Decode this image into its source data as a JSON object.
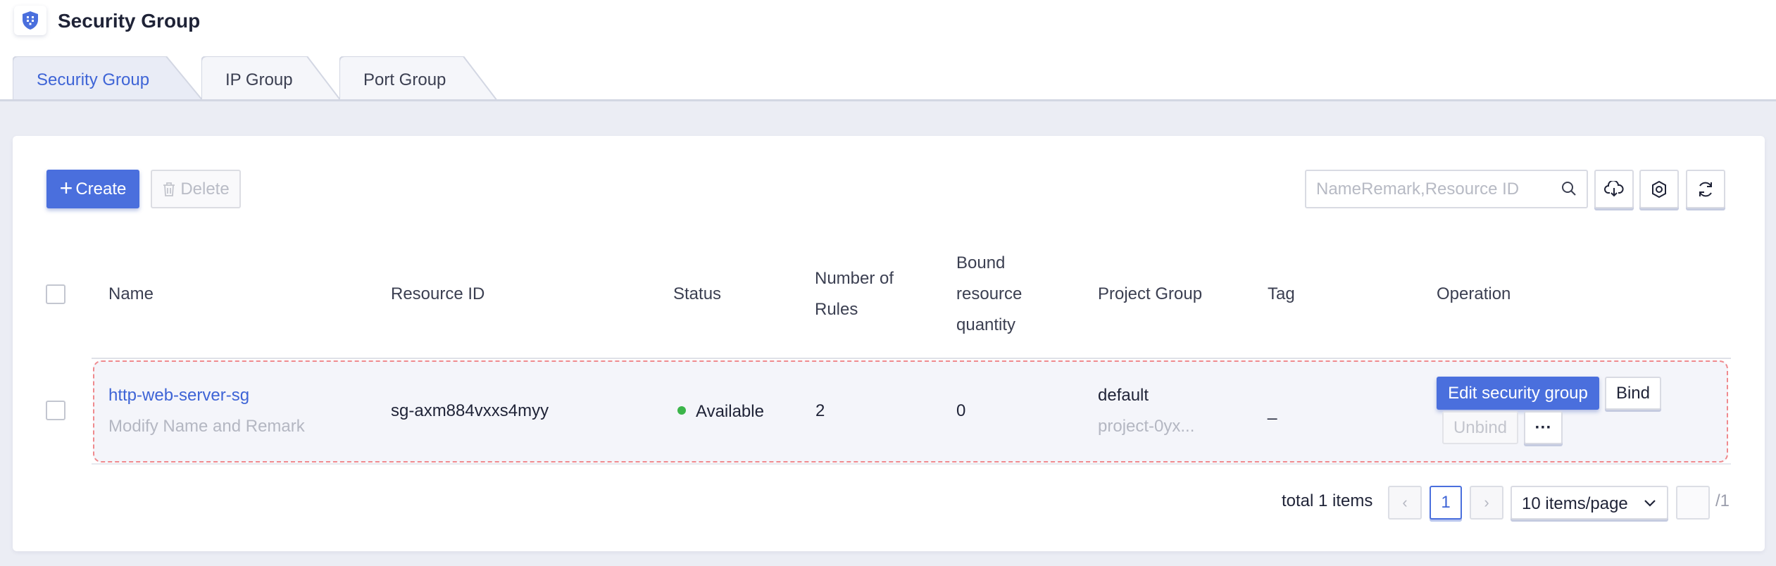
{
  "header": {
    "title": "Security Group",
    "logo_icon": "shield-icon"
  },
  "tabs": [
    {
      "label": "Security Group",
      "active": true
    },
    {
      "label": "IP Group",
      "active": false
    },
    {
      "label": "Port Group",
      "active": false
    }
  ],
  "toolbar": {
    "create_label": "Create",
    "delete_label": "Delete",
    "search_placeholder": "NameRemark,Resource ID",
    "icons": [
      "search-icon",
      "cloud-download-icon",
      "settings-icon",
      "refresh-icon"
    ]
  },
  "table": {
    "columns": {
      "name": "Name",
      "resource_id": "Resource ID",
      "status": "Status",
      "rules_l1": "Number of",
      "rules_l2": "Rules",
      "bound_l1": "Bound",
      "bound_l2": "resource",
      "bound_l3": "quantity",
      "project_group": "Project Group",
      "tag": "Tag",
      "operation": "Operation"
    },
    "rows": [
      {
        "name": "http-web-server-sg",
        "remark": "Modify Name and Remark",
        "resource_id": "sg-axm884vxxs4myy",
        "status": "Available",
        "rules": "2",
        "bound": "0",
        "project_group": "default",
        "project_id": "project-0yx...",
        "tag": "_",
        "ops": {
          "edit": "Edit security group",
          "bind": "Bind",
          "unbind": "Unbind",
          "more": "···"
        }
      }
    ]
  },
  "pagination": {
    "total_text": "total 1 items",
    "prev": "‹",
    "next": "›",
    "current_page": "1",
    "page_size": "10 items/page",
    "total_pages": "/1"
  },
  "colors": {
    "accent": "#4a6fdd",
    "status_available": "#3bb54a",
    "background": "#ebedf4"
  }
}
